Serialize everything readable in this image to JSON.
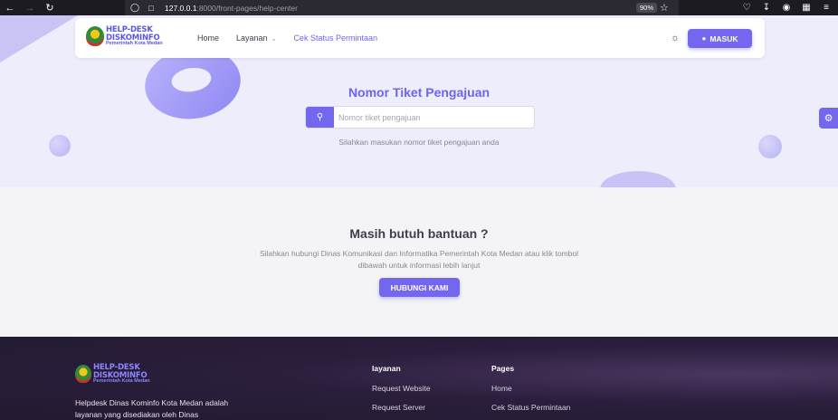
{
  "browser": {
    "url_host": "127.0.0.1",
    "url_path": ":8000/front-pages/help-center",
    "zoom": "90%"
  },
  "navbar": {
    "logo_title_1": "HELP-DESK",
    "logo_title_2": "DISKOMINFO",
    "logo_subtitle": "Pemerintah Kota Medan",
    "links": [
      "Home",
      "Layanan",
      "Cek Status Permintaan"
    ],
    "login_label": "MASUK"
  },
  "hero": {
    "title": "Nomor Tiket Pengajuan",
    "search_placeholder": "Nomor tiket pengajuan",
    "search_value": "",
    "hint": "Silahkan masukan nomor tiket pengajuan anda"
  },
  "help": {
    "title": "Masih butuh bantuan ?",
    "text": "Silahkan hubungi Dinas Komunikasi dan Informatika Pemerintah Kota Medan atau klik tombol dibawah untuk informasi lebih lanjut",
    "button_label": "HUBUNGI KAMI"
  },
  "footer": {
    "logo_title_1": "HELP-DESK",
    "logo_title_2": "DISKOMINFO",
    "logo_subtitle": "Pemerintah Kota Medan",
    "description": "Helpdesk Dinas Kominfo Kota Medan adalah layanan yang disediakan oleh Dinas",
    "layanan": {
      "title": "layanan",
      "links": [
        "Request Website",
        "Request Server"
      ]
    },
    "pages": {
      "title": "Pages",
      "links": [
        "Home",
        "Cek Status Permintaan"
      ]
    }
  },
  "colors": {
    "primary": "#7367f0",
    "hero_bg": "#eeedfb",
    "footer_bg": "#2a1e3c"
  }
}
